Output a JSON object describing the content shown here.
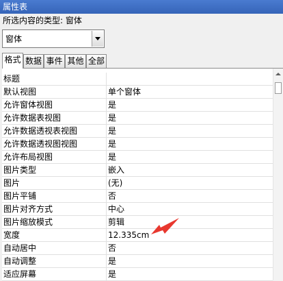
{
  "window": {
    "title": "属性表"
  },
  "selection": {
    "label": "所选内容的类型: 窗体",
    "value": "窗体"
  },
  "tabs": [
    {
      "label": "格式",
      "active": true
    },
    {
      "label": "数据",
      "active": false
    },
    {
      "label": "事件",
      "active": false
    },
    {
      "label": "其他",
      "active": false
    },
    {
      "label": "全部",
      "active": false
    }
  ],
  "properties": [
    {
      "name": "标题",
      "value": ""
    },
    {
      "name": "默认视图",
      "value": "单个窗体"
    },
    {
      "name": "允许窗体视图",
      "value": "是"
    },
    {
      "name": "允许数据表视图",
      "value": "是"
    },
    {
      "name": "允许数据透视表视图",
      "value": "是"
    },
    {
      "name": "允许数据透视图视图",
      "value": "是"
    },
    {
      "name": "允许布局视图",
      "value": "是"
    },
    {
      "name": "图片类型",
      "value": "嵌入"
    },
    {
      "name": "图片",
      "value": "(无)"
    },
    {
      "name": "图片平铺",
      "value": "否"
    },
    {
      "name": "图片对齐方式",
      "value": "中心"
    },
    {
      "name": "图片缩放模式",
      "value": "剪辑"
    },
    {
      "name": "宽度",
      "value": "12.335cm"
    },
    {
      "name": "自动居中",
      "value": "否"
    },
    {
      "name": "自动调整",
      "value": "是"
    },
    {
      "name": "适应屏幕",
      "value": "是"
    }
  ],
  "colors": {
    "annotation_arrow": "#e8382f",
    "title_bar": "#3d6cc1"
  },
  "icons": {
    "dropdown": "chevron-down-icon",
    "scroll_up": "arrow-up-icon"
  }
}
